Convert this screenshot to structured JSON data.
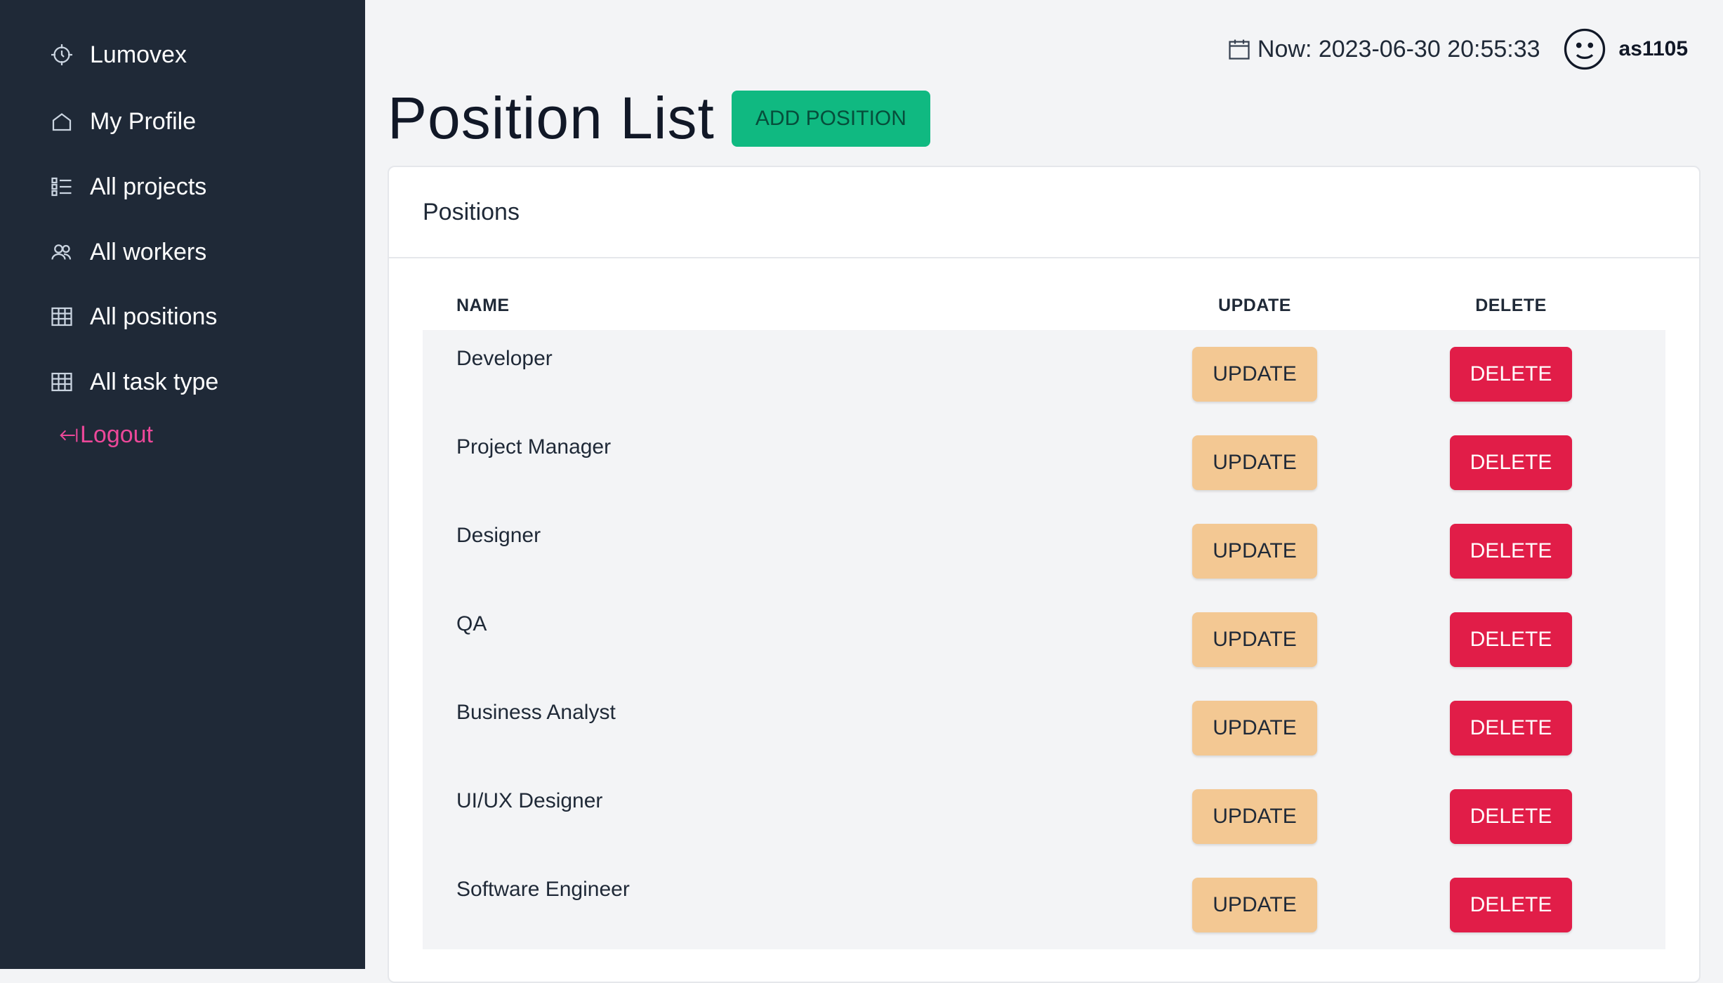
{
  "sidebar": {
    "brand": "Lumovex",
    "items": [
      {
        "label": "My Profile",
        "icon": "home-icon"
      },
      {
        "label": "All projects",
        "icon": "checklist-icon"
      },
      {
        "label": "All workers",
        "icon": "users-icon"
      },
      {
        "label": "All positions",
        "icon": "table-icon"
      },
      {
        "label": "All task type",
        "icon": "table-icon"
      }
    ],
    "logout": "Logout"
  },
  "header": {
    "datetime": "Now: 2023-06-30 20:55:33",
    "username": "as1105"
  },
  "page": {
    "title": "Position List",
    "add_button": "ADD POSITION"
  },
  "card": {
    "title": "Positions",
    "columns": [
      "NAME",
      "UPDATE",
      "DELETE"
    ],
    "rows": [
      {
        "name": "Developer",
        "update": "UPDATE",
        "delete": "DELETE"
      },
      {
        "name": "Project Manager",
        "update": "UPDATE",
        "delete": "DELETE"
      },
      {
        "name": "Designer",
        "update": "UPDATE",
        "delete": "DELETE"
      },
      {
        "name": "QA",
        "update": "UPDATE",
        "delete": "DELETE"
      },
      {
        "name": "Business Analyst",
        "update": "UPDATE",
        "delete": "DELETE"
      },
      {
        "name": "UI/UX Designer",
        "update": "UPDATE",
        "delete": "DELETE"
      },
      {
        "name": "Software Engineer",
        "update": "UPDATE",
        "delete": "DELETE"
      }
    ]
  },
  "colors": {
    "sidebar_bg": "#1f2937",
    "add_button": "#10b981",
    "update_button": "#f3c893",
    "delete_button": "#e11d48",
    "logout": "#ec4899"
  }
}
